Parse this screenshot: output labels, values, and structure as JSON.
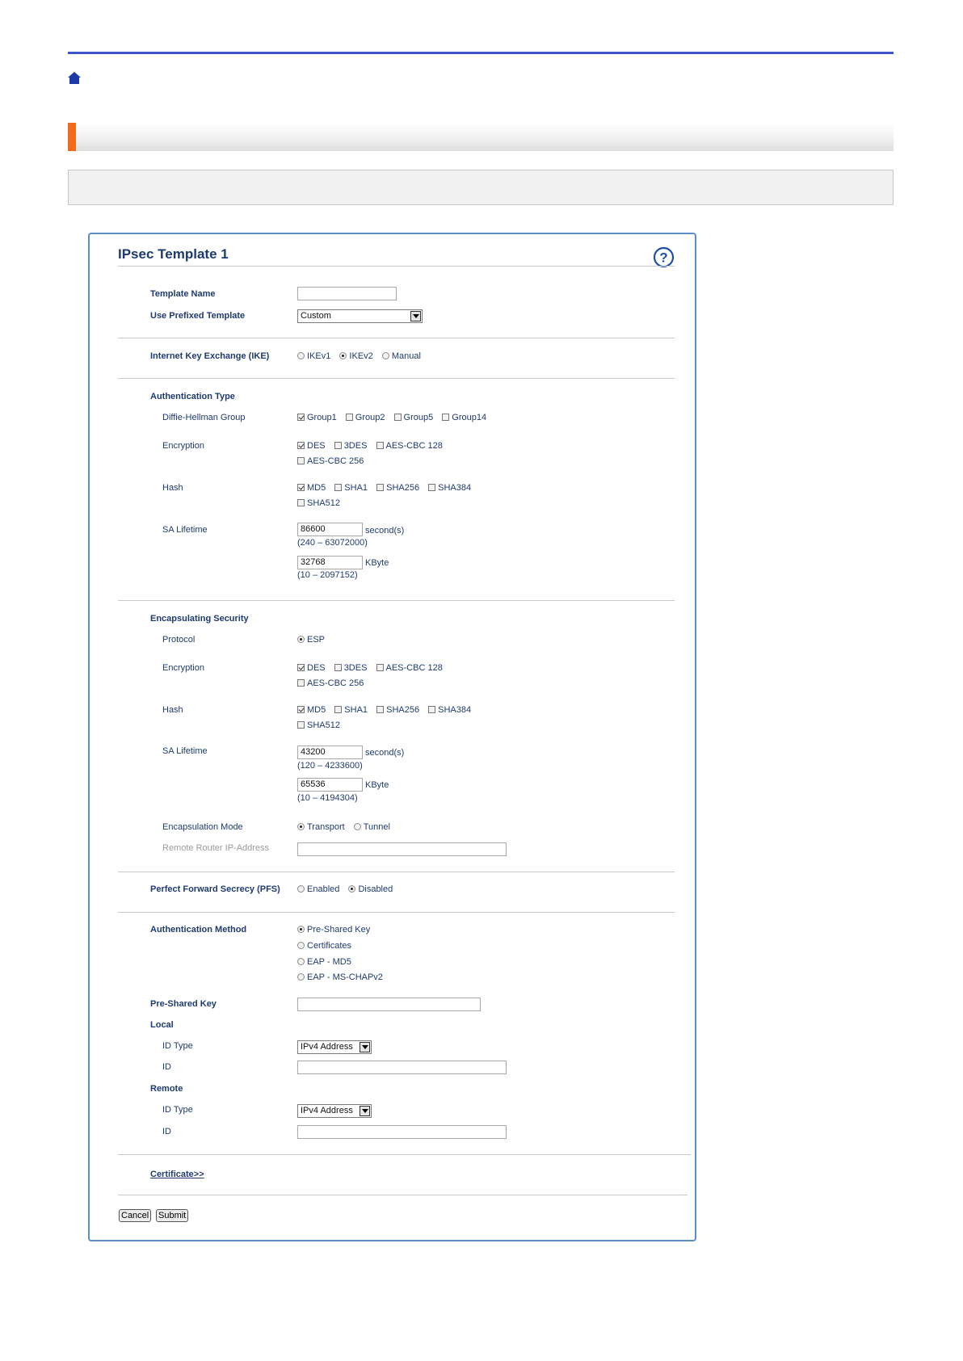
{
  "title": "IPsec Template 1",
  "template_name": {
    "label": "Template Name",
    "value": ""
  },
  "prefixed_template": {
    "label": "Use Prefixed Template",
    "value": "Custom"
  },
  "ike": {
    "label": "Internet Key Exchange (IKE)",
    "options": [
      "IKEv1",
      "IKEv2",
      "Manual"
    ],
    "selected": "IKEv2"
  },
  "auth_type": {
    "heading": "Authentication Type",
    "dh_label": "Diffie-Hellman Group",
    "dh_options": [
      "Group1",
      "Group2",
      "Group5",
      "Group14"
    ],
    "enc_label": "Encryption",
    "enc_options": [
      "DES",
      "3DES",
      "AES-CBC 128",
      "AES-CBC 256"
    ],
    "hash_label": "Hash",
    "hash_options": [
      "MD5",
      "SHA1",
      "SHA256",
      "SHA384",
      "SHA512"
    ],
    "sa_label": "SA Lifetime",
    "sa_seconds": "86600",
    "sa_seconds_unit": "second(s)",
    "sa_seconds_range": "(240 – 63072000)",
    "sa_kbyte": "32768",
    "sa_kbyte_unit": "KByte",
    "sa_kbyte_range": "(10 – 2097152)"
  },
  "encap": {
    "heading": "Encapsulating Security",
    "protocol_label": "Protocol",
    "protocol_value": "ESP",
    "enc_label": "Encryption",
    "enc_options": [
      "DES",
      "3DES",
      "AES-CBC 128",
      "AES-CBC 256"
    ],
    "hash_label": "Hash",
    "hash_options": [
      "MD5",
      "SHA1",
      "SHA256",
      "SHA384",
      "SHA512"
    ],
    "sa_label": "SA Lifetime",
    "sa_seconds": "43200",
    "sa_seconds_unit": "second(s)",
    "sa_seconds_range": "(120 – 4233600)",
    "sa_kbyte": "65536",
    "sa_kbyte_unit": "KByte",
    "sa_kbyte_range": "(10 – 4194304)",
    "mode_label": "Encapsulation Mode",
    "mode_options": [
      "Transport",
      "Tunnel"
    ],
    "mode_selected": "Transport",
    "remote_router_label": "Remote Router IP-Address",
    "remote_router_value": ""
  },
  "pfs": {
    "label": "Perfect Forward Secrecy (PFS)",
    "options": [
      "Enabled",
      "Disabled"
    ],
    "selected": "Disabled"
  },
  "auth_method": {
    "label": "Authentication Method",
    "options": [
      "Pre-Shared Key",
      "Certificates",
      "EAP - MD5",
      "EAP - MS-CHAPv2"
    ],
    "selected": "Pre-Shared Key"
  },
  "psk": {
    "label": "Pre-Shared Key",
    "value": ""
  },
  "local": {
    "heading": "Local",
    "id_type_label": "ID Type",
    "id_type_value": "IPv4 Address",
    "id_label": "ID",
    "id_value": ""
  },
  "remote": {
    "heading": "Remote",
    "id_type_label": "ID Type",
    "id_type_value": "IPv4 Address",
    "id_label": "ID",
    "id_value": ""
  },
  "certificate_link": "Certificate>>",
  "buttons": {
    "cancel": "Cancel",
    "submit": "Submit"
  },
  "colors": {
    "accent": "#f26b1d",
    "rule": "#3d55c8",
    "panel_border": "#5b8fc9",
    "text": "#1f3a6e"
  }
}
